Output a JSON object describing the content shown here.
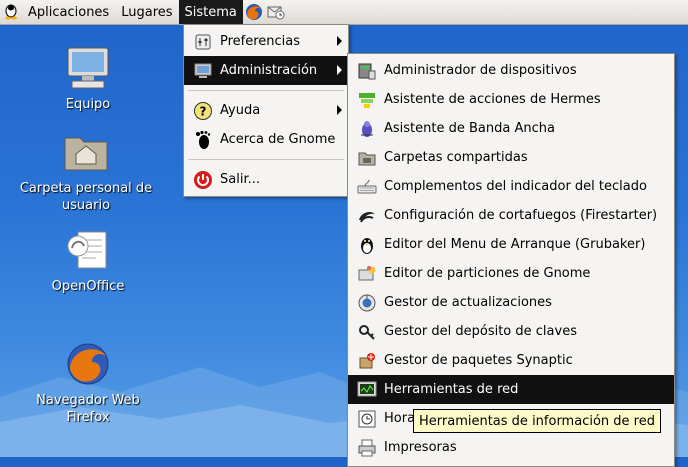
{
  "panel": {
    "menus": [
      "Aplicaciones",
      "Lugares",
      "Sistema"
    ],
    "icons": [
      "gnome-foot-icon",
      "firefox-icon",
      "mail-clock-icon"
    ]
  },
  "desktop": [
    {
      "label": "Equipo",
      "icon": "computer-icon"
    },
    {
      "label": "Carpeta personal de usuario",
      "icon": "home-folder-icon"
    },
    {
      "label": "OpenOffice",
      "icon": "openoffice-icon"
    },
    {
      "label": "Navegador Web Firefox",
      "icon": "firefox-icon"
    }
  ],
  "sistema_menu": [
    {
      "label": "Preferencias",
      "icon": "preferences-icon",
      "submenu": true
    },
    {
      "label": "Administración",
      "icon": "monitor-icon",
      "submenu": true,
      "selected": true
    },
    {
      "label": "Ayuda",
      "icon": "help-icon",
      "submenu": true
    },
    {
      "label": "Acerca de Gnome",
      "icon": "gnome-icon"
    },
    {
      "label": "Salir...",
      "icon": "power-icon"
    }
  ],
  "admin_menu": [
    {
      "label": "Administrador de dispositivos"
    },
    {
      "label": "Asistente de acciones de Hermes"
    },
    {
      "label": "Asistente de Banda Ancha"
    },
    {
      "label": "Carpetas compartidas"
    },
    {
      "label": "Complementos del indicador del teclado"
    },
    {
      "label": "Configuración de cortafuegos (Firestarter)"
    },
    {
      "label": "Editor del Menu de Arranque (Grubaker)"
    },
    {
      "label": "Editor de particiones de Gnome"
    },
    {
      "label": "Gestor de actualizaciones"
    },
    {
      "label": "Gestor del depósito de claves"
    },
    {
      "label": "Gestor de paquetes Synaptic"
    },
    {
      "label": "Herramientas de red",
      "selected": true
    },
    {
      "label": "Hora"
    },
    {
      "label": "Impresoras"
    }
  ],
  "tooltip": "Herramientas de información de red",
  "colors": {
    "selection": "#111111",
    "tooltip_bg": "#fffbc8",
    "desktop_blue": "#2a74d6"
  }
}
